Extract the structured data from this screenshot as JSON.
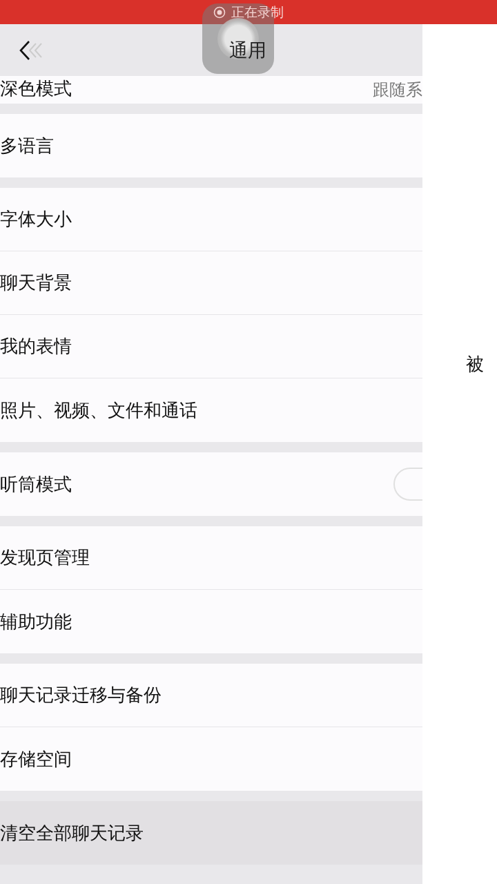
{
  "recording_bar": {
    "label": "正在录制"
  },
  "nav": {
    "title": "通用"
  },
  "groups": [
    {
      "items": [
        {
          "label": "深色模式",
          "kind": "value",
          "value": "跟随系",
          "selected": false
        }
      ]
    },
    {
      "items": [
        {
          "label": "多语言",
          "kind": "link",
          "selected": false
        }
      ]
    },
    {
      "items": [
        {
          "label": "字体大小",
          "kind": "link",
          "selected": false
        },
        {
          "label": "聊天背景",
          "kind": "link",
          "selected": false
        },
        {
          "label": "我的表情",
          "kind": "link",
          "selected": false
        },
        {
          "label": "照片、视频、文件和通话",
          "kind": "link",
          "selected": false
        }
      ]
    },
    {
      "items": [
        {
          "label": "听筒模式",
          "kind": "toggle",
          "on": false,
          "selected": false
        }
      ]
    },
    {
      "items": [
        {
          "label": "发现页管理",
          "kind": "link",
          "selected": false
        },
        {
          "label": "辅助功能",
          "kind": "link",
          "selected": false
        }
      ]
    },
    {
      "items": [
        {
          "label": "聊天记录迁移与备份",
          "kind": "link",
          "selected": false
        },
        {
          "label": "存储空间",
          "kind": "link",
          "selected": false
        }
      ]
    },
    {
      "items": [
        {
          "label": "清空全部聊天记录",
          "kind": "link",
          "selected": true
        }
      ]
    }
  ],
  "next_page": {
    "text": "被"
  }
}
